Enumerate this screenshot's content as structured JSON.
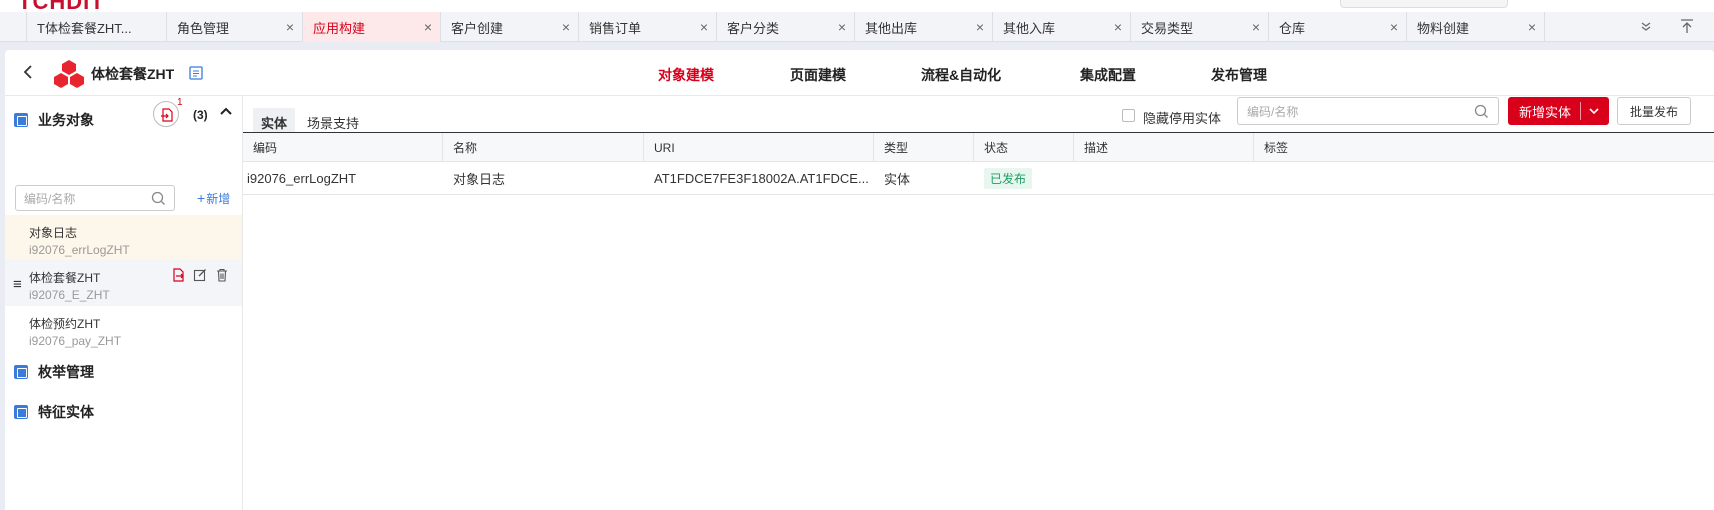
{
  "brand": "TCHDIT",
  "tabs": [
    {
      "label": "T体检套餐ZHT...",
      "active": false
    },
    {
      "label": "角色管理",
      "active": false
    },
    {
      "label": "应用构建",
      "active": true
    },
    {
      "label": "客户创建",
      "active": false
    },
    {
      "label": "销售订单",
      "active": false
    },
    {
      "label": "客户分类",
      "active": false
    },
    {
      "label": "其他出库",
      "active": false
    },
    {
      "label": "其他入库",
      "active": false
    },
    {
      "label": "交易类型",
      "active": false
    },
    {
      "label": "仓库",
      "active": false
    },
    {
      "label": "物料创建",
      "active": false
    }
  ],
  "tab_close_glyph": "×",
  "app": {
    "title": "体检套餐ZHT",
    "nav": [
      {
        "label": "对象建模",
        "active": true
      },
      {
        "label": "页面建模",
        "active": false
      },
      {
        "label": "流程&自动化",
        "active": false
      },
      {
        "label": "集成配置",
        "active": false
      },
      {
        "label": "发布管理",
        "active": false
      }
    ]
  },
  "sidebar": {
    "business_objects": {
      "label": "业务对象",
      "badge": "1",
      "count": "(3)"
    },
    "search_placeholder": "编码/名称",
    "add_label": "新增",
    "items": [
      {
        "name": "对象日志",
        "code": "i92076_errLogZHT",
        "selected": true
      },
      {
        "name": "体检套餐ZHT",
        "code": "i92076_E_ZHT",
        "hover": true
      },
      {
        "name": "体检预约ZHT",
        "code": "i92076_pay_ZHT"
      }
    ],
    "enum_label": "枚举管理",
    "feature_label": "特征实体"
  },
  "content": {
    "subtabs": [
      {
        "label": "实体",
        "active": true
      },
      {
        "label": "场景支持",
        "active": false
      }
    ],
    "hide_disabled_label": "隐藏停用实体",
    "search_placeholder": "编码/名称",
    "new_entity_label": "新增实体",
    "batch_publish_label": "批量发布",
    "columns": [
      "编码",
      "名称",
      "URI",
      "类型",
      "状态",
      "描述",
      "标签"
    ],
    "rows": [
      {
        "code": "i92076_errLogZHT",
        "name": "对象日志",
        "uri": "AT1FDCE7FE3F18002A.AT1FDCE...",
        "type": "实体",
        "status": "已发布",
        "desc": "",
        "tag": ""
      }
    ]
  },
  "colors": {
    "accent": "#d9001b",
    "link": "#3a7bdc",
    "published": "#1e9e63"
  }
}
